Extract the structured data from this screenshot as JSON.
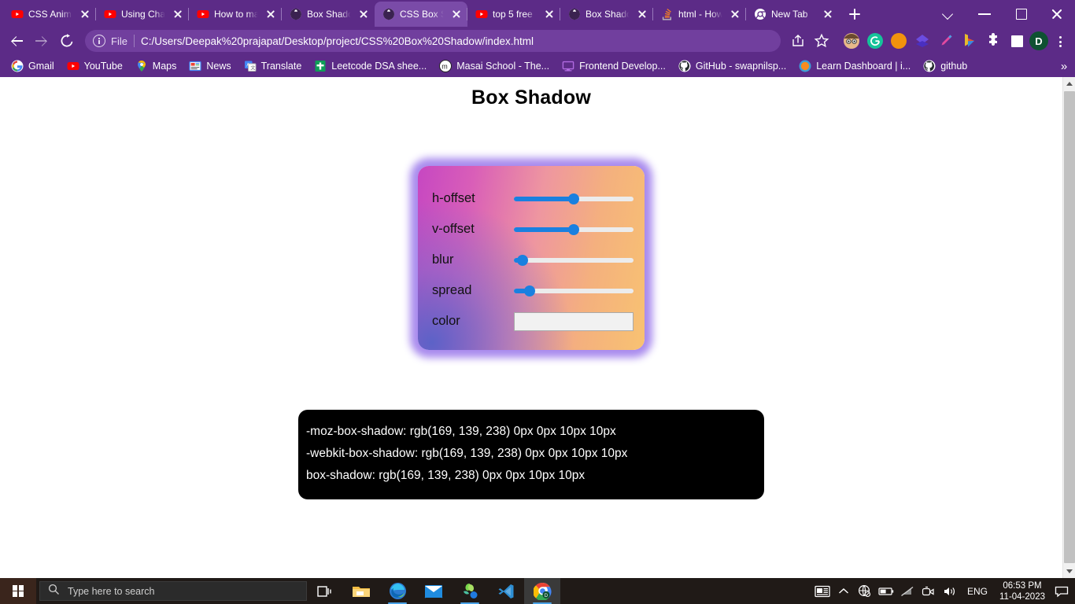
{
  "browser": {
    "tabs": [
      {
        "title": "CSS Anima",
        "favicon": "youtube-icon",
        "active": false
      },
      {
        "title": "Using Chat",
        "favicon": "youtube-icon",
        "active": false
      },
      {
        "title": "How to ma",
        "favicon": "youtube-icon",
        "active": false
      },
      {
        "title": "Box Shado",
        "favicon": "globe-icon",
        "active": false
      },
      {
        "title": "CSS Box Sh",
        "favicon": "globe-icon",
        "active": true
      },
      {
        "title": "top 5 free",
        "favicon": "youtube-icon",
        "active": false
      },
      {
        "title": "Box Shado",
        "favicon": "globe-icon",
        "active": false
      },
      {
        "title": "html - How",
        "favicon": "stackoverflow-icon",
        "active": false
      },
      {
        "title": "New Tab",
        "favicon": "chrome-icon",
        "active": false
      }
    ],
    "new_tab_label": "+",
    "window_controls": {
      "chevron": "chevron-down-icon",
      "minimize": "minimize-icon",
      "maximize": "maximize-icon",
      "close": "close-icon"
    },
    "toolbar": {
      "back": "back-arrow-icon",
      "forward": "forward-arrow-icon",
      "reload": "reload-icon",
      "omnibox": {
        "info_icon": "info-circle-icon",
        "scheme_label": "File",
        "url": "C:/Users/Deepak%20prajapat/Desktop/project/CSS%20Box%20Shadow/index.html"
      },
      "share": "share-icon",
      "bookmark_star": "star-icon",
      "extensions": [
        "avatar-face-icon",
        "grammarly-icon",
        "honey-icon",
        "diamond-icon",
        "highlighter-pen-icon",
        "bing-icon",
        "puzzle-piece-icon",
        "white-square-icon"
      ],
      "profile_initial": "D",
      "menu": "three-dot-menu-icon"
    },
    "bookmarks": [
      {
        "label": "Gmail",
        "favicon": "gmail-icon"
      },
      {
        "label": "YouTube",
        "favicon": "youtube-icon"
      },
      {
        "label": "Maps",
        "favicon": "maps-pin-icon"
      },
      {
        "label": "News",
        "favicon": "google-news-icon"
      },
      {
        "label": "Translate",
        "favicon": "google-translate-icon"
      },
      {
        "label": "Leetcode DSA shee...",
        "favicon": "green-sheet-icon"
      },
      {
        "label": "Masai School - The...",
        "favicon": "masai-m-icon"
      },
      {
        "label": "Frontend Develop...",
        "favicon": "monitor-icon"
      },
      {
        "label": "GitHub - swapnilsp...",
        "favicon": "github-icon"
      },
      {
        "label": "Learn Dashboard | i...",
        "favicon": "orange-circle-icon"
      },
      {
        "label": "github",
        "favicon": "github-icon"
      }
    ],
    "bookmarks_overflow": "»",
    "scrollbar": {
      "up": "scroll-up-arrow-icon",
      "down": "scroll-down-arrow-icon"
    }
  },
  "page": {
    "title": "Box Shadow",
    "controls": [
      {
        "label": "h-offset",
        "type": "range",
        "percent": 50
      },
      {
        "label": "v-offset",
        "type": "range",
        "percent": 50
      },
      {
        "label": "blur",
        "type": "range",
        "percent": 7
      },
      {
        "label": "spread",
        "type": "range",
        "percent": 13
      }
    ],
    "color_control": {
      "label": "color",
      "value": "#a98bee"
    },
    "output_lines": [
      "-moz-box-shadow: rgb(169, 139, 238) 0px 0px 10px 10px",
      "-webkit-box-shadow: rgb(169, 139, 238) 0px 0px 10px 10px",
      "box-shadow: rgb(169, 139, 238) 0px 0px 10px 10px"
    ],
    "shadow_color": "#a98bee",
    "card_gradient_from": "#c647c2",
    "card_gradient_to": "#f8c272"
  },
  "taskbar": {
    "start": "windows-logo-icon",
    "search_placeholder": "Type here to search",
    "search_icon": "search-icon",
    "items": [
      "task-view-icon",
      "file-explorer-icon",
      "microsoft-edge-icon",
      "mail-icon",
      "flower-app-icon",
      "vs-code-icon",
      "google-chrome-icon"
    ],
    "tray": {
      "news_widget": "news-weather-icon",
      "overflow": "chevron-up-icon",
      "network": "globe-no-internet-icon",
      "battery": "battery-icon",
      "disconnected": "no-connection-icon",
      "camera": "camera-icon",
      "volume": "speaker-icon",
      "language": "ENG",
      "time": "06:53 PM",
      "date": "11-04-2023",
      "notifications": "notification-icon"
    }
  }
}
